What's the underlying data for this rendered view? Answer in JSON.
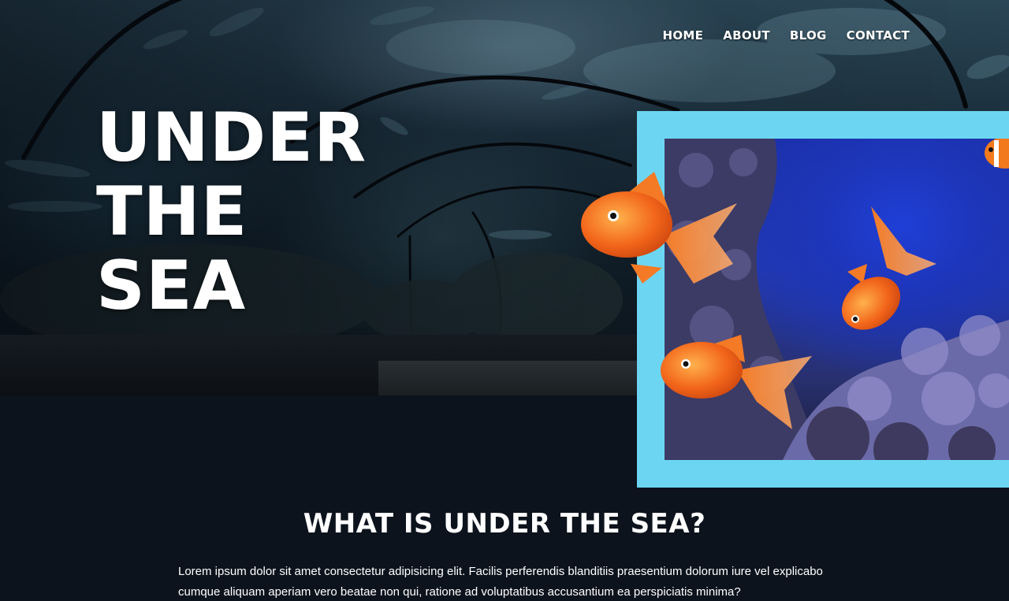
{
  "nav": {
    "items": [
      {
        "label": "HOME"
      },
      {
        "label": "ABOUT"
      },
      {
        "label": "BLOG"
      },
      {
        "label": "CONTACT"
      }
    ]
  },
  "hero": {
    "title_lines": [
      "UNDER",
      "THE",
      "SEA"
    ]
  },
  "section": {
    "heading": "WHAT IS UNDER THE SEA?",
    "body": "Lorem ipsum dolor sit amet consectetur adipisicing elit. Facilis perferendis blanditiis praesentium dolorum iure vel explicabo cumque aliquam aperiam vero beatae non qui, ratione ad voluptatibus accusantium ea perspiciatis minima?"
  },
  "colors": {
    "page_background": "#0d131d",
    "frame_accent": "#6cd6f2",
    "goldfish": "#f26b1d"
  },
  "images": {
    "hero_background": "aquarium-tunnel-photo",
    "framed_photo": "coral-reef-goldfish-photo"
  }
}
